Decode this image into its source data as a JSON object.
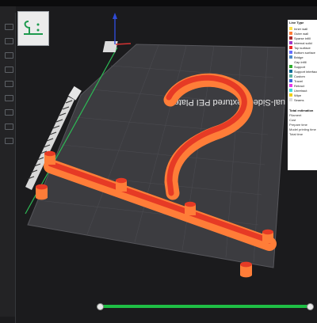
{
  "bed": {
    "label": "Dual-Sided Textured PEI Plate"
  },
  "thumbnail": {
    "icon": "hook-model-thumbnail-icon"
  },
  "legend": {
    "header": "Line Type",
    "items": [
      {
        "label": "Inner wall",
        "color": "#ffe24a"
      },
      {
        "label": "Outer wall",
        "color": "#ff7d38"
      },
      {
        "label": "Sparse infill",
        "color": "#b02f2f"
      },
      {
        "label": "Internal solid",
        "color": "#a03cc8"
      },
      {
        "label": "Top surface",
        "color": "#ee2c2c"
      },
      {
        "label": "Bottom surface",
        "color": "#6a6fff"
      },
      {
        "label": "Bridge",
        "color": "#4f8cc9"
      },
      {
        "label": "Gap infill",
        "color": "#ffffff"
      },
      {
        "label": "Support",
        "color": "#2fad2f"
      },
      {
        "label": "Support interface",
        "color": "#12709a"
      },
      {
        "label": "Custom",
        "color": "#5eb3a0"
      },
      {
        "label": "Travel",
        "color": "#3b6be0"
      },
      {
        "label": "Retract",
        "color": "#e93ae9"
      },
      {
        "label": "Unretract",
        "color": "#40dcdc"
      },
      {
        "label": "Wipe",
        "color": "#f0d01a"
      },
      {
        "label": "Seams",
        "color": "#d9d9d9"
      }
    ]
  },
  "stats": {
    "header": "Total estimation",
    "rows": [
      {
        "label": "Filament"
      },
      {
        "label": "Cost"
      },
      {
        "label": "Prepare time"
      },
      {
        "label": "Model printing time"
      },
      {
        "label": "Total time"
      }
    ]
  },
  "layer_slider": {
    "range_start_fraction": 0.0,
    "range_end_fraction": 1.0,
    "color": "#1fbf45"
  },
  "colors": {
    "model_outer": "#ff7d38",
    "model_top": "#e63a25",
    "plate": "#3c3c40",
    "background": "#1b1b1d"
  }
}
